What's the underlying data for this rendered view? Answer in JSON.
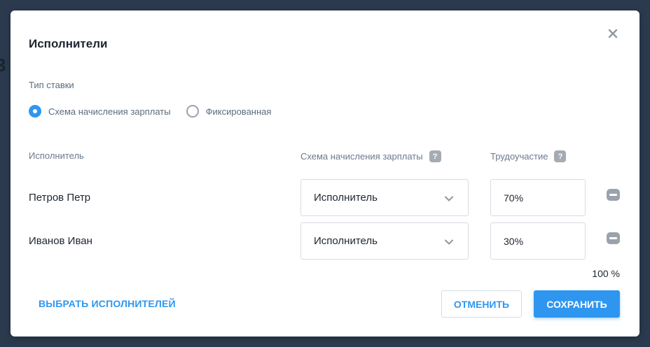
{
  "dialog": {
    "title": "Исполнители",
    "rate_type_label": "Тип ставки",
    "rate_options": [
      {
        "label": "Схема начисления зарплаты",
        "selected": true
      },
      {
        "label": "Фиксированная",
        "selected": false
      }
    ],
    "columns": {
      "performer": "Исполнитель",
      "salary_scheme": "Схема начисления зарплаты",
      "participation": "Трудоучастие",
      "help_icon": "?"
    },
    "rows": [
      {
        "name": "Петров Петр",
        "scheme": "Исполнитель",
        "share": "70%"
      },
      {
        "name": "Иванов Иван",
        "scheme": "Исполнитель",
        "share": "30%"
      }
    ],
    "total": "100 %",
    "select_performers": "ВЫБРАТЬ ИСПОЛНИТЕЛЕЙ",
    "cancel": "ОТМЕНИТЬ",
    "save": "СОХРАНИТЬ"
  },
  "colors": {
    "accent": "#2f96f0",
    "backdrop": "#2b3a4e"
  }
}
